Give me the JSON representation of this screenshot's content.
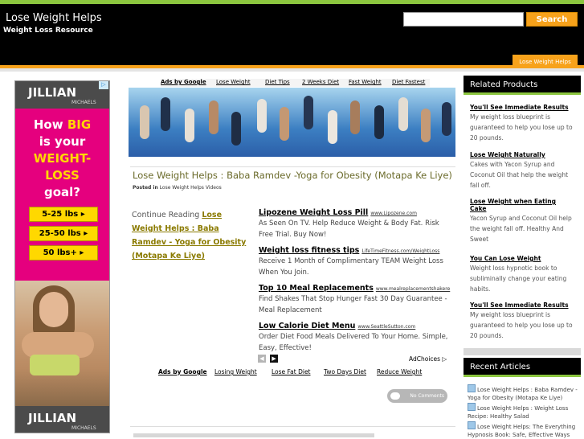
{
  "header": {
    "site_title": "Lose Weight Helps",
    "site_description": "Weight Loss Resource",
    "search_placeholder": "",
    "search_button": "Search",
    "nav_tab": "Lose Weight Helps"
  },
  "left_ad": {
    "brand": "JILLIAN",
    "brand_sub": "MICHAELS",
    "question_line1": "How ",
    "question_big": "BIG",
    "question_line2": "is your",
    "question_line3": "WEIGHT-",
    "question_line4": "LOSS",
    "question_line5": "goal?",
    "buttons": [
      "5-25 lbs ▸",
      "25-50 lbs ▸",
      "50 lbs+ ▸"
    ],
    "footer_brand": "JILLIAN",
    "footer_sub": "MICHAELS"
  },
  "ad_links_top": {
    "label": "Ads by Google",
    "links": [
      "Lose Weight",
      "Diet Tips",
      "2 Weeks Diet",
      "Fast Weight",
      "Diet Fastest"
    ]
  },
  "post": {
    "title": "Lose Weight Helps : Baba Ramdev -Yoga for Obesity (Motapa Ke Liye)",
    "posted_in_label": "Posted in",
    "category": "Lose Weight Helps Videos",
    "continue_prefix": "Continue Reading ",
    "continue_link": "Lose Weight Helps : Baba Ramdev - Yoga for Obesity (Motapa Ke Liye)"
  },
  "text_ads": [
    {
      "title": "Lipozene Weight Loss Pill",
      "url": "www.Lipozene.com",
      "desc": "As Seen On TV. Help Reduce Weight & Body Fat. Risk Free Trial. Buy Now!"
    },
    {
      "title": "Weight loss fitness tips",
      "url": "LifeTimeFitness.com/WeightLoss",
      "desc": "Receive 1 Month of Complimentary TEAM Weight Loss When You Join."
    },
    {
      "title": "Top 10 Meal Replacements",
      "url": "www.mealreplacementshakere",
      "desc": "Find Shakes That Stop Hunger Fast 30 Day Guarantee - Meal Replacement"
    },
    {
      "title": "Low Calorie Diet Menu",
      "url": "www.SeattleSutton.com",
      "desc": "Order Diet Food Meals Delivered To Your Home. Simple, Easy, Effective!"
    }
  ],
  "ad_choices": "AdChoices ▷",
  "ad_links_bottom": {
    "label": "Ads by Google",
    "links": [
      "Losing Weight",
      "Lose Fat Diet",
      "Two Days Diet",
      "Reduce Weight"
    ]
  },
  "comments": "No Comments",
  "sidebar": {
    "products_title": "Related Products",
    "products": [
      {
        "title": "You'll See Immediate Results",
        "desc": "My weight loss blueprint is guaranteed to help you lose up to 20 pounds."
      },
      {
        "title": "Lose Weight Naturally",
        "desc": "Cakes with Yacon Syrup and Coconut Oil that help the weight fall off."
      },
      {
        "title": "Lose Weight when Eating Cake",
        "desc": "Yacon Syrup and Coconut Oil help the weight fall off. Healthy And Sweet"
      },
      {
        "title": "You Can Lose Weight",
        "desc": "Weight loss hypnotic book to subliminally change your eating habits."
      },
      {
        "title": "You'll See Immediate Results",
        "desc": "My weight loss blueprint is guaranteed to help you lose up to 20 pounds."
      }
    ],
    "recent_title": "Recent Articles",
    "recent": [
      "Lose Weight Helps : Baba Ramdev -Yoga for Obesity (Motapa Ke Liye)",
      "Lose Weight Helps : Weight Loss Recipe: Healthy Salad",
      "Lose Weight Helps: The Everything Hypnosis Book: Safe, Effective Ways"
    ]
  }
}
